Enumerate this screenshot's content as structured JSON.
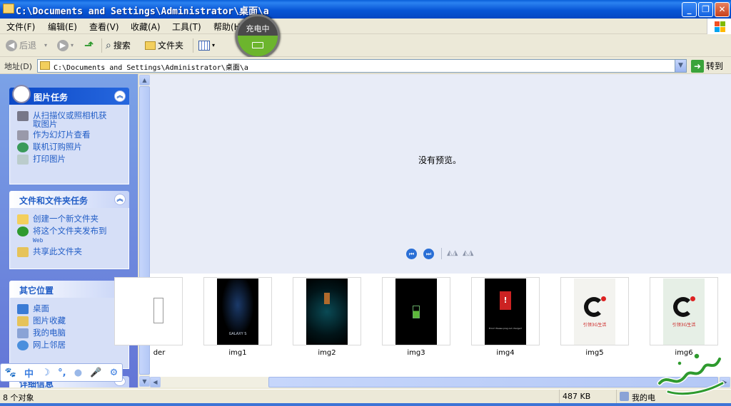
{
  "window": {
    "title": "C:\\Documents and Settings\\Administrator\\桌面\\a",
    "minimize": "_",
    "maximize": "❐",
    "close": "✕"
  },
  "menu": [
    "文件(F)",
    "编辑(E)",
    "查看(V)",
    "收藏(A)",
    "工具(T)",
    "帮助(H)"
  ],
  "toolbar": {
    "back": "后退",
    "forward": "▾",
    "search": "搜索",
    "folders": "文件夹"
  },
  "charging": {
    "label": "充电中"
  },
  "address": {
    "label": "地址(D)",
    "value": "C:\\Documents and Settings\\Administrator\\桌面\\a",
    "go": "转到"
  },
  "panels": {
    "picture_tasks": {
      "title": "图片任务",
      "items": [
        "从扫描仪或照相机获取图片",
        "作为幻灯片查看",
        "联机订购照片",
        "打印图片"
      ]
    },
    "file_tasks": {
      "title": "文件和文件夹任务",
      "items": [
        "创建一个新文件夹",
        "将这个文件夹发布到",
        "共享此文件夹"
      ],
      "publish_sub": "Web"
    },
    "other_places": {
      "title": "其它位置",
      "items": [
        "桌面",
        "图片收藏",
        "我的电脑",
        "网上邻居"
      ]
    },
    "details": {
      "title": "详细信息"
    }
  },
  "preview": {
    "message": "没有预览。"
  },
  "thumbnails": [
    {
      "label": "der"
    },
    {
      "label": "img1",
      "caption": "GALAXY S"
    },
    {
      "label": "img2"
    },
    {
      "label": "img3"
    },
    {
      "label": "img4",
      "caption": "Error! Please plug out charger!"
    },
    {
      "label": "img5",
      "caption": "引领3G生活"
    },
    {
      "label": "img6",
      "caption": "引领3G生活"
    }
  ],
  "status": {
    "count": "8 个对象",
    "size": "487 KB",
    "location": "我的电"
  },
  "ime": {
    "mode": "中"
  },
  "colors": {
    "titlebar": "#0a5fd9",
    "panel": "#6375d6",
    "accent_blue": "#215dc6"
  }
}
